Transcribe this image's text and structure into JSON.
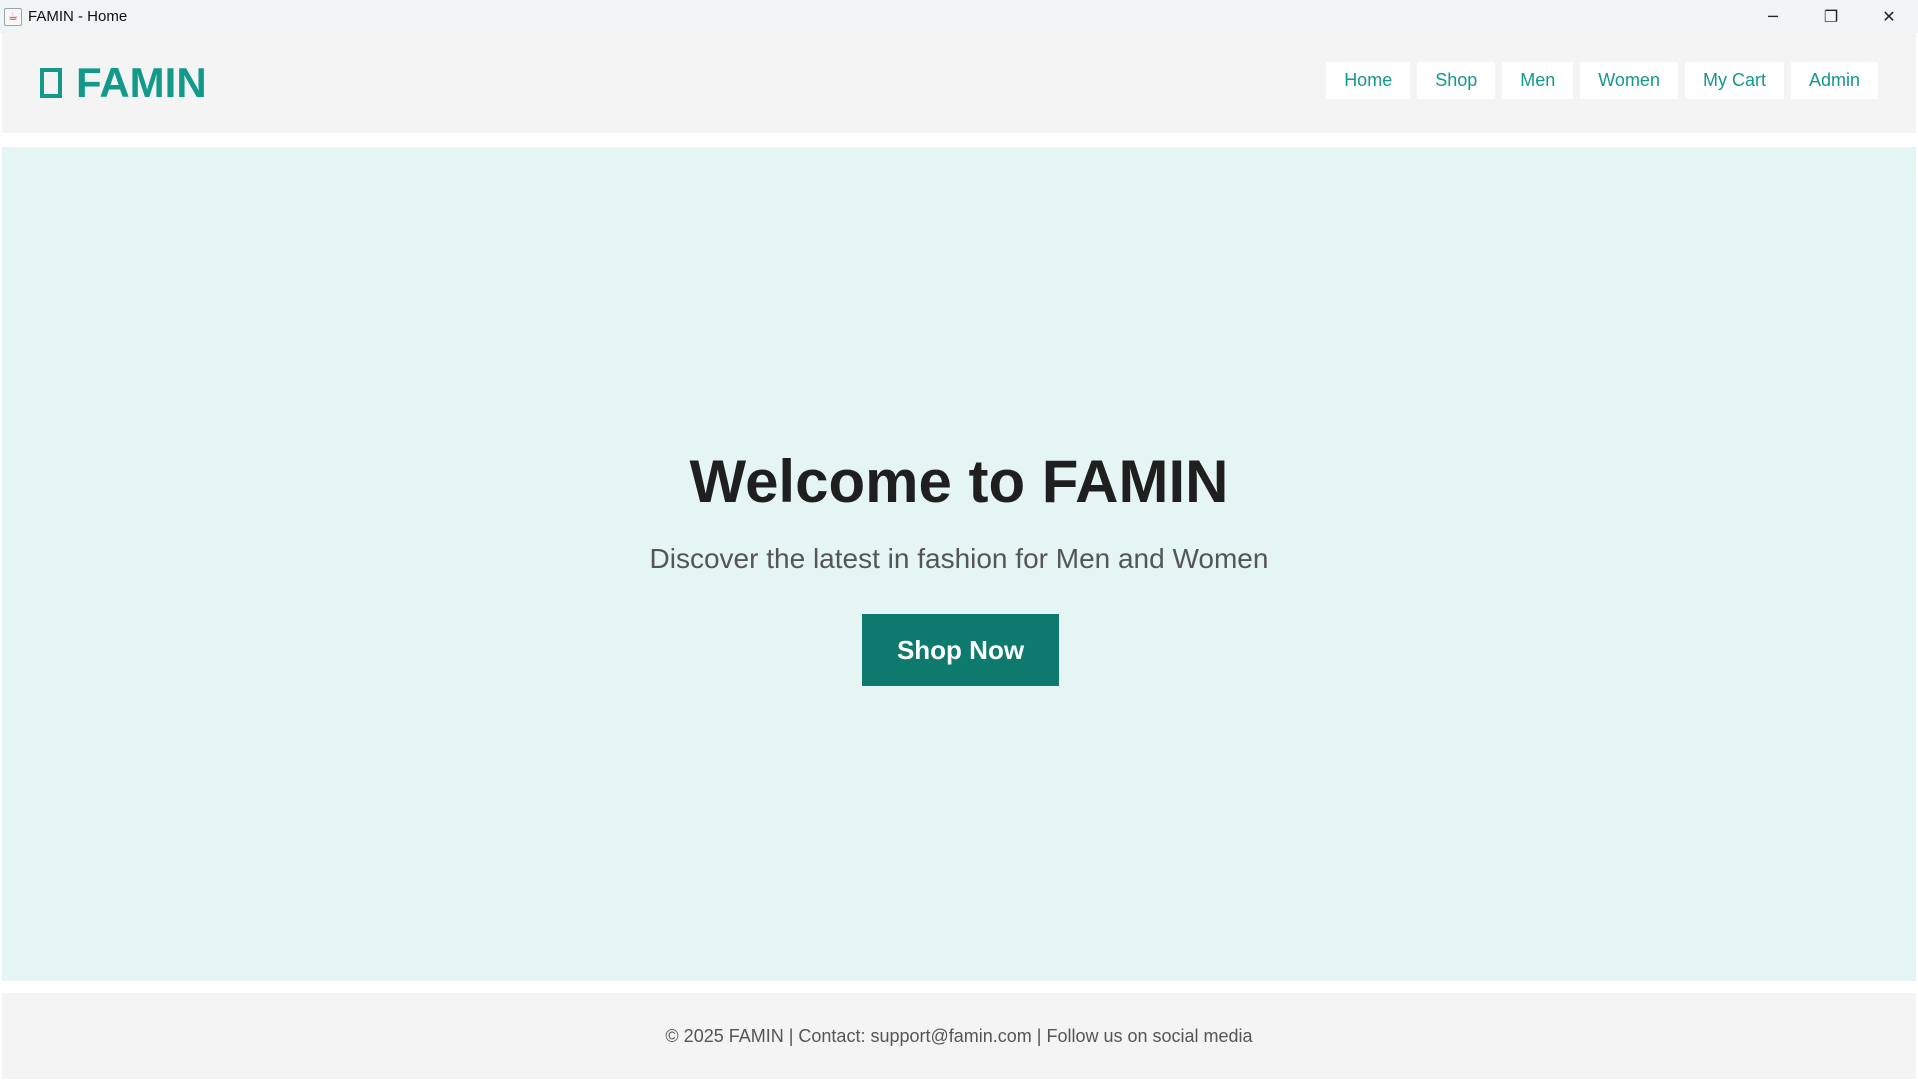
{
  "window": {
    "title": "FAMIN - Home",
    "controls": {
      "minimize": "─",
      "restore": "❐",
      "close": "✕"
    }
  },
  "header": {
    "brand": "FAMIN",
    "brand_icon": "rectangle-icon",
    "nav": [
      {
        "label": "Home"
      },
      {
        "label": "Shop"
      },
      {
        "label": "Men"
      },
      {
        "label": "Women"
      },
      {
        "label": "My Cart"
      },
      {
        "label": "Admin"
      }
    ]
  },
  "hero": {
    "title": "Welcome to FAMIN",
    "subtitle": "Discover the latest in fashion for Men and Women",
    "cta": "Shop Now"
  },
  "footer": {
    "text": "© 2025 FAMIN | Contact: support@famin.com | Follow us on social media"
  },
  "colors": {
    "accent": "#12998a",
    "cta_bg": "#0e7a6e",
    "hero_bg": "#e5f5f4",
    "header_bg": "#f4f4f4"
  }
}
